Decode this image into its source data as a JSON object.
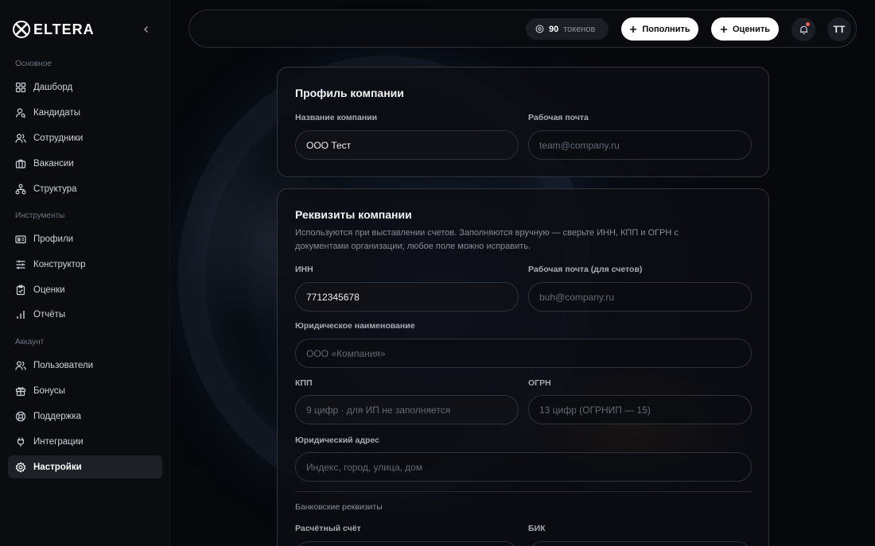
{
  "brand": {
    "name": "ELTERA"
  },
  "sidebar": {
    "sections": [
      {
        "label": "Основное",
        "items": [
          {
            "label": "Дашборд",
            "icon": "grid-icon"
          },
          {
            "label": "Кандидаты",
            "icon": "user-search-icon"
          },
          {
            "label": "Сотрудники",
            "icon": "users-icon"
          },
          {
            "label": "Вакансии",
            "icon": "briefcase-icon"
          },
          {
            "label": "Структура",
            "icon": "hierarchy-icon"
          }
        ]
      },
      {
        "label": "Инструменты",
        "items": [
          {
            "label": "Профили",
            "icon": "id-card-icon"
          },
          {
            "label": "Конструктор",
            "icon": "sliders-icon"
          },
          {
            "label": "Оценки",
            "icon": "clipboard-check-icon"
          },
          {
            "label": "Отчёты",
            "icon": "bar-chart-icon"
          }
        ]
      },
      {
        "label": "Аккаунт",
        "items": [
          {
            "label": "Пользователи",
            "icon": "users-icon"
          },
          {
            "label": "Бонусы",
            "icon": "gift-icon"
          },
          {
            "label": "Поддержка",
            "icon": "lifebuoy-icon"
          },
          {
            "label": "Интеграции",
            "icon": "plug-icon"
          },
          {
            "label": "Настройки",
            "icon": "gear-icon",
            "active": true
          }
        ]
      }
    ]
  },
  "topbar": {
    "tokens_count": "90",
    "tokens_label": "токенов",
    "topup_label": "Пополнить",
    "rate_label": "Оценить",
    "avatar_initials": "TT"
  },
  "profile_card": {
    "title": "Профиль компании",
    "company_name_label": "Название компании",
    "company_name_value": "ООО Тест",
    "work_email_label": "Рабочая почта",
    "work_email_placeholder": "team@company.ru"
  },
  "requisites_card": {
    "title": "Реквизиты компании",
    "description": "Используются при выставлении счетов. Заполняются вручную — сверьте ИНН, КПП и ОГРН с документами организации; любое поле можно исправить.",
    "inn_label": "ИНН",
    "inn_value": "7712345678",
    "billing_email_label": "Рабочая почта (для счетов)",
    "billing_email_placeholder": "buh@company.ru",
    "legal_name_label": "Юридическое наименование",
    "legal_name_placeholder": "ООО «Компания»",
    "kpp_label": "КПП",
    "kpp_placeholder": "9 цифр · для ИП не заполняется",
    "ogrn_label": "ОГРН",
    "ogrn_placeholder": "13 цифр (ОГРНИП — 15)",
    "legal_address_label": "Юридический адрес",
    "legal_address_placeholder": "Индекс, город, улица, дом",
    "bank_section_label": "Банковские реквизиты",
    "account_label": "Расчётный счёт",
    "bik_label": "БИК"
  },
  "colors": {
    "background": "#07090d",
    "card_border": "#30343c",
    "active_nav": "#1d2027",
    "accent_white": "#ffffff",
    "notification": "#ff5a5a"
  }
}
